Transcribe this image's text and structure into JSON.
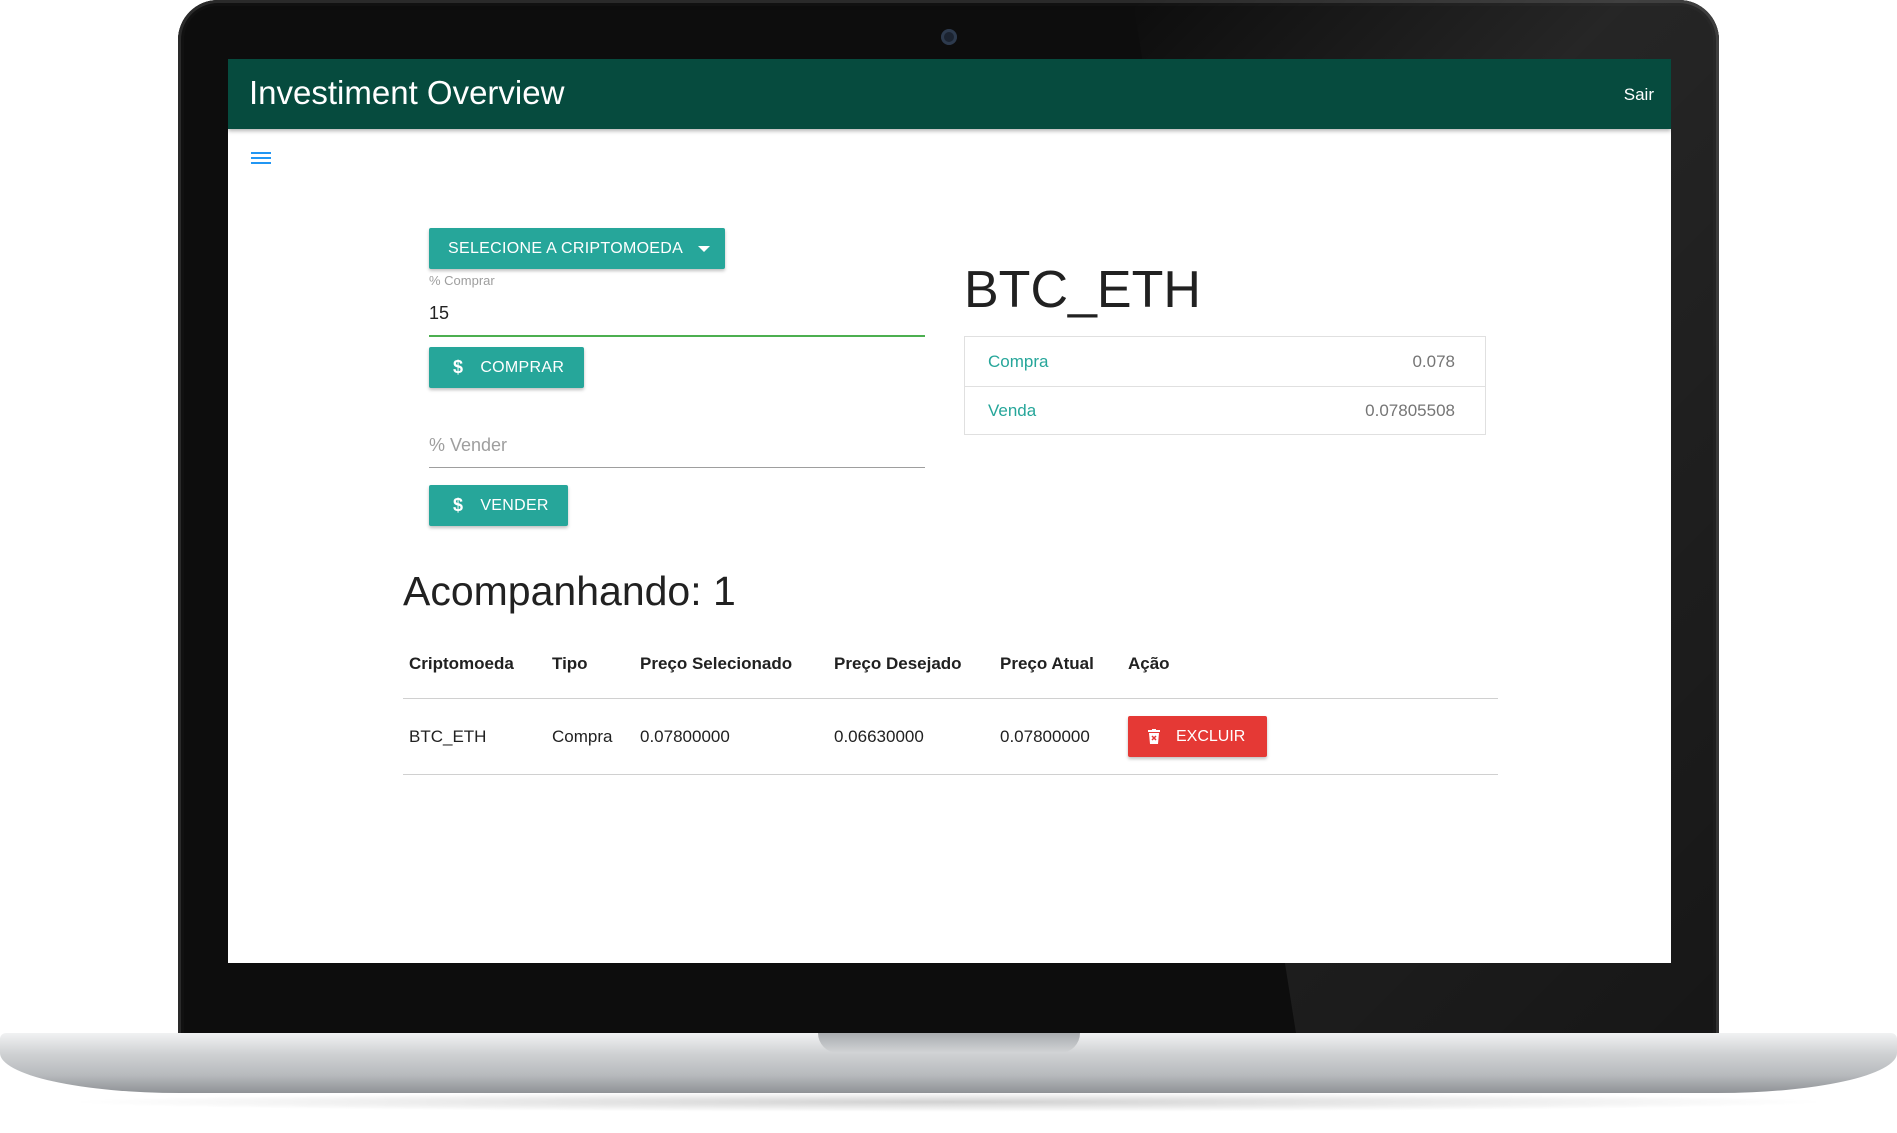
{
  "app": {
    "title": "Investiment Overview",
    "logout_label": "Sair"
  },
  "controls": {
    "select_crypto_label": "SELECIONE A CRIPTOMOEDA",
    "buy_percent_label": "% Comprar",
    "buy_percent_value": "15",
    "buy_button_label": "COMPRAR",
    "sell_percent_placeholder": "% Vender",
    "sell_button_label": "VENDER",
    "currency_icon": "dollar-icon"
  },
  "pair": {
    "name": "BTC_ETH",
    "rows": [
      {
        "label": "Compra",
        "value": "0.078"
      },
      {
        "label": "Venda",
        "value": "0.07805508"
      }
    ]
  },
  "tracking": {
    "title": "Acompanhando: 1",
    "columns": [
      "Criptomoeda",
      "Tipo",
      "Preço Selecionado",
      "Preço Desejado",
      "Preço Atual",
      "Ação"
    ],
    "rows": [
      {
        "crypto": "BTC_ETH",
        "type": "Compra",
        "selected_price": "0.07800000",
        "desired_price": "0.06630000",
        "current_price": "0.07800000",
        "action_label": "EXCLUIR"
      }
    ]
  },
  "colors": {
    "appbar": "#064b3e",
    "accent": "#26a69a",
    "danger": "#e53935",
    "focus_underline": "#4caf50"
  }
}
